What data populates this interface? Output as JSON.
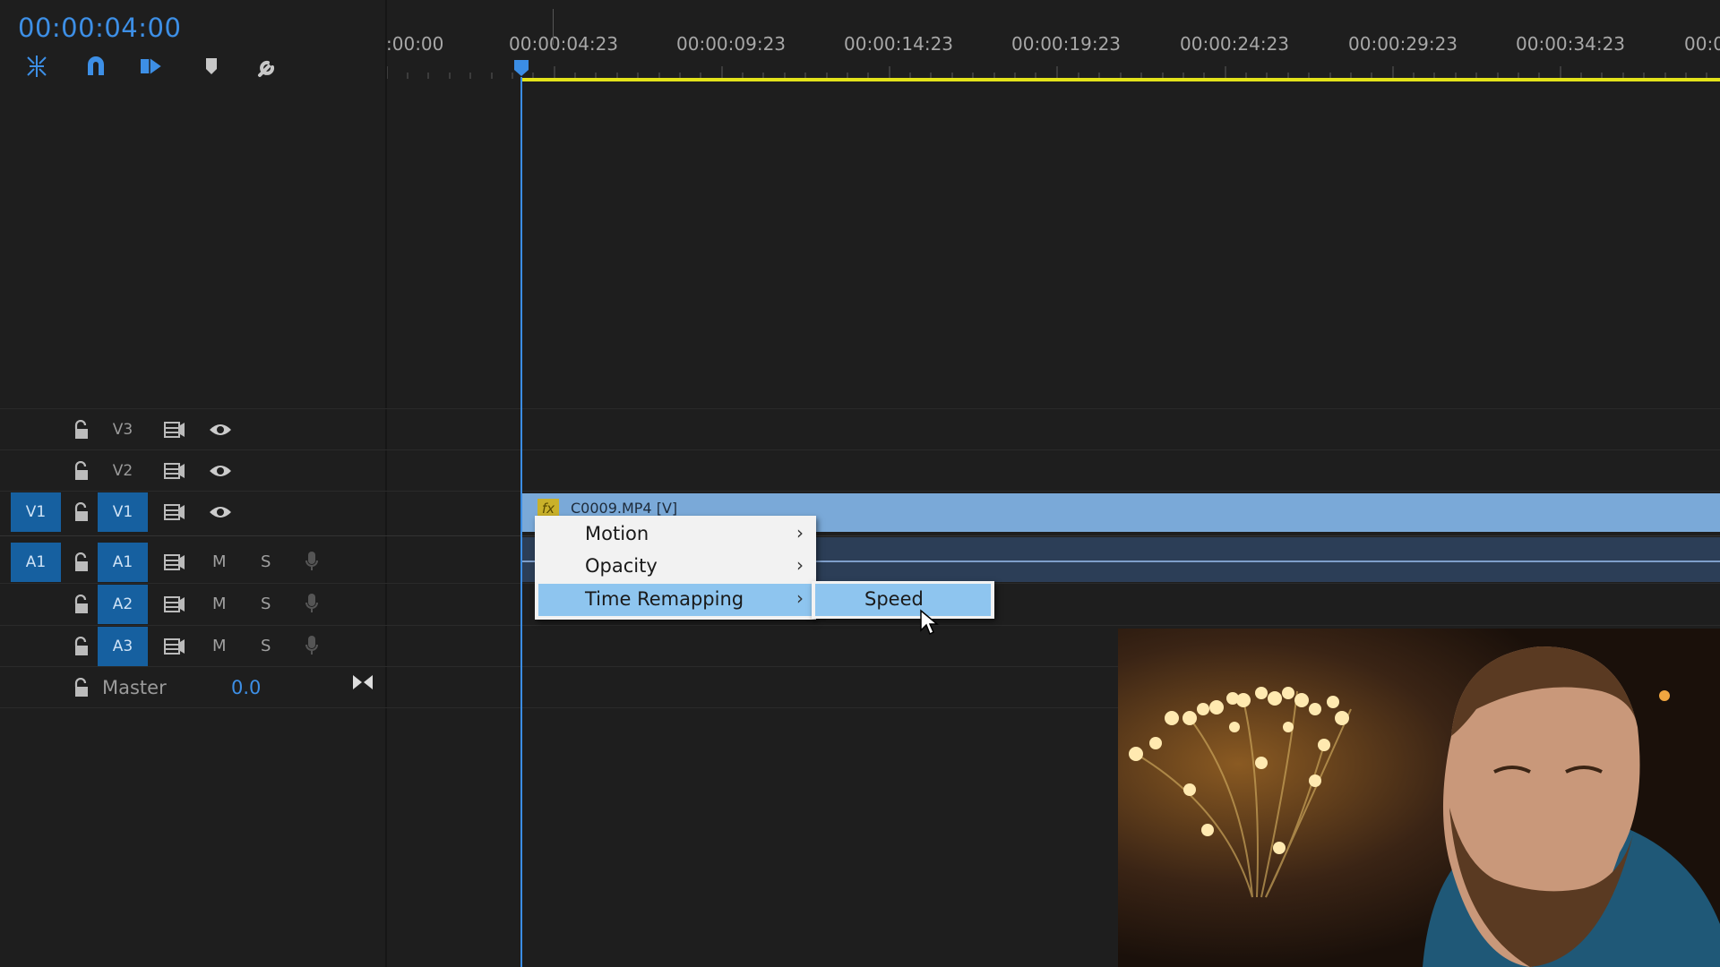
{
  "header": {
    "timecode": "00:00:04:00"
  },
  "tools": [
    {
      "name": "insert-overwrite-icon"
    },
    {
      "name": "snap-magnet-icon"
    },
    {
      "name": "linked-selection-icon"
    },
    {
      "name": "add-marker-icon"
    },
    {
      "name": "settings-wrench-icon"
    }
  ],
  "ruler": {
    "labels": [
      ":00:00",
      "00:00:04:23",
      "00:00:09:23",
      "00:00:14:23",
      "00:00:19:23",
      "00:00:24:23",
      "00:00:29:23",
      "00:00:34:23",
      "00:0"
    ]
  },
  "tracks": {
    "v3": {
      "name": "V3"
    },
    "v2": {
      "name": "V2"
    },
    "v1": {
      "name": "V1",
      "source": "V1"
    },
    "a1": {
      "name": "A1",
      "source": "A1",
      "mute": "M",
      "solo": "S"
    },
    "a2": {
      "name": "A2",
      "mute": "M",
      "solo": "S"
    },
    "a3": {
      "name": "A3",
      "mute": "M",
      "solo": "S"
    },
    "master": {
      "label": "Master",
      "value": "0.0"
    }
  },
  "clip": {
    "fx_badge": "fx",
    "name": "C0009.MP4 [V]"
  },
  "context_menu": {
    "items": [
      {
        "label": "Motion",
        "arrow": "›"
      },
      {
        "label": "Opacity",
        "arrow": "›"
      },
      {
        "label": "Time Remapping",
        "arrow": "›"
      }
    ],
    "submenu": {
      "label": "Speed"
    }
  },
  "colors": {
    "accent_blue": "#3d8fe6",
    "clip_video": "#7aa9d8",
    "menu_highlight": "#8ec5ef",
    "work_area": "#e3e31a"
  }
}
